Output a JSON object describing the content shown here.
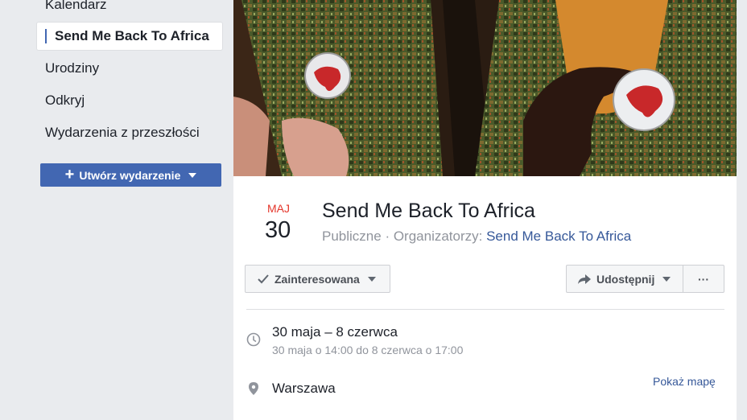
{
  "sidebar": {
    "items": [
      {
        "label": "Kalendarz"
      },
      {
        "label": "Send Me Back To Africa"
      },
      {
        "label": "Urodziny"
      },
      {
        "label": "Odkryj"
      },
      {
        "label": "Wydarzenia z przeszłości"
      }
    ],
    "create_button": "Utwórz wydarzenie"
  },
  "event": {
    "month": "MAJ",
    "day": "30",
    "title": "Send Me Back To Africa",
    "visibility": "Publiczne",
    "separator": " · ",
    "organizers_label": "Organizatorzy: ",
    "organizer": "Send Me Back To Africa",
    "interest_button": "Zainteresowana",
    "share_button": "Udostępnij",
    "more_button": "···",
    "time_main": "30 maja – 8 czerwca",
    "time_detail": "30 maja o 14:00 do 8 czerwca o 17:00",
    "place": "Warszawa",
    "map_link": "Pokaż mapę"
  },
  "colors": {
    "accent": "#4267b2",
    "month": "#e4362b",
    "link": "#365899"
  },
  "icons": [
    "plus-icon",
    "caret-down-icon",
    "check-icon",
    "share-arrow-icon",
    "clock-icon",
    "map-pin-icon"
  ]
}
